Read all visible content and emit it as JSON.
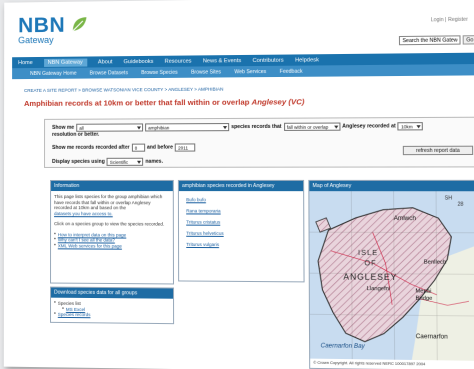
{
  "logo": {
    "name": "NBN",
    "sub": "Gateway"
  },
  "header": {
    "login": "Login | Register",
    "search_label": "Search the NBN Gateway",
    "search_button": "Go"
  },
  "nav": [
    "Home",
    "NBN Gateway",
    "About",
    "Guidebooks",
    "Resources",
    "News & Events",
    "Contributors",
    "Helpdesk"
  ],
  "subnav": [
    "NBN Gateway Home",
    "Browse Datasets",
    "Browse Species",
    "Browse Sites",
    "Web Services",
    "Feedback"
  ],
  "breadcrumb": "CREATE A SITE REPORT > BROWSE WATSONIAN VICE COUNTY > ANGLESEY > AMPHIBIAN",
  "title": {
    "main": "Amphibian records at 10km or better that fall within or overlap ",
    "place": "Anglesey (VC)"
  },
  "form": {
    "show_me": "Show me",
    "group_a": "all",
    "group_b": "amphibian",
    "species_records_that": "species records that",
    "overlap_option": "fall within or overlap",
    "recorded_at": "Anglesey recorded at",
    "resolution_value": "10km",
    "resolution_suffix": "resolution or better.",
    "after_label": "Show me records recorded after",
    "after_value": "0",
    "before_label": "and before",
    "before_value": "2011",
    "display_label": "Display species using",
    "names_option": "Scientific",
    "names_suffix": "names.",
    "refresh": "refresh report data"
  },
  "info": {
    "heading": "Information",
    "text_1": "This page lists species for the group amphibian which have records that fall within or overlap Anglesey recorded at 10km and based on the",
    "link_sources": "datasets you have access to.",
    "text_2": "Click on a species group to view the species recorded.",
    "links": [
      "How to interpret data on this page",
      "Why can't I see all the data?",
      "XML Web services for this page"
    ]
  },
  "download": {
    "heading": "Download species data for all groups",
    "species_list": "Species list",
    "ms_excel": "MS Excel",
    "species_records": "Species records"
  },
  "species": {
    "heading": "amphibian species recorded in Anglesey",
    "items": [
      "Bufo bufo",
      "Rana temporaria",
      "Triturus cristatus",
      "Triturus helveticus",
      "Triturus vulgaris"
    ]
  },
  "map": {
    "heading": "Map of Anglesey",
    "labels": {
      "amlwch": "Amlwch",
      "isle": "ISLE",
      "of": "OF",
      "anglesey": "ANGLESEY",
      "llangefni": "Llangefni",
      "benllech": "Benllech",
      "menai": "Menai",
      "bridge": "Bridge",
      "caernarfon": "Caernarfon",
      "bay": "Caernarfon Bay",
      "sh": "SH",
      "grid_num": "28"
    },
    "copyright": "© Crown Copyright. All rights reserved NERC 100017897 2004"
  }
}
